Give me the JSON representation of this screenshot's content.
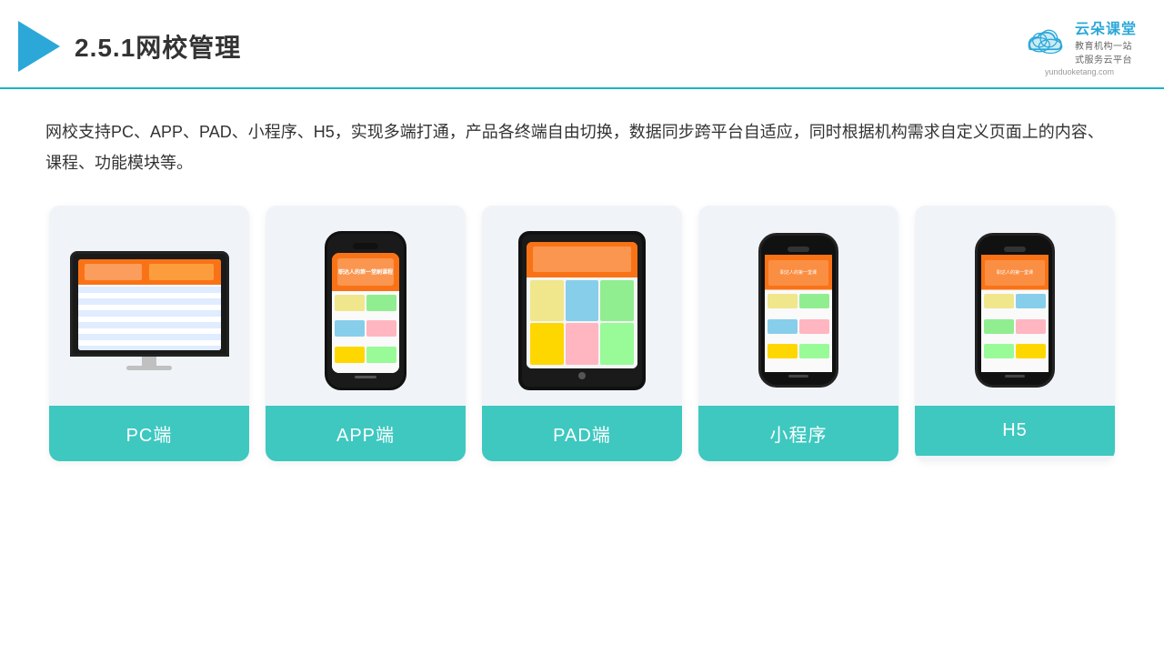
{
  "header": {
    "section_number": "2.5.1",
    "title": "网校管理",
    "brand_name": "云朵课堂",
    "brand_url": "yunduoketang.com",
    "brand_tagline": "教育机构一站",
    "brand_tagline2": "式服务云平台"
  },
  "description": "网校支持PC、APP、PAD、小程序、H5，实现多端打通，产品各终端自由切换，数据同步跨平台自适应，同时根据机构需求自定义页面上的内容、课程、功能模块等。",
  "cards": [
    {
      "id": "pc",
      "label": "PC端"
    },
    {
      "id": "app",
      "label": "APP端"
    },
    {
      "id": "pad",
      "label": "PAD端"
    },
    {
      "id": "mini",
      "label": "小程序"
    },
    {
      "id": "h5",
      "label": "H5"
    }
  ],
  "colors": {
    "accent": "#1ab3c8",
    "teal": "#3ec8c0",
    "dark": "#333",
    "orange": "#f97316"
  }
}
